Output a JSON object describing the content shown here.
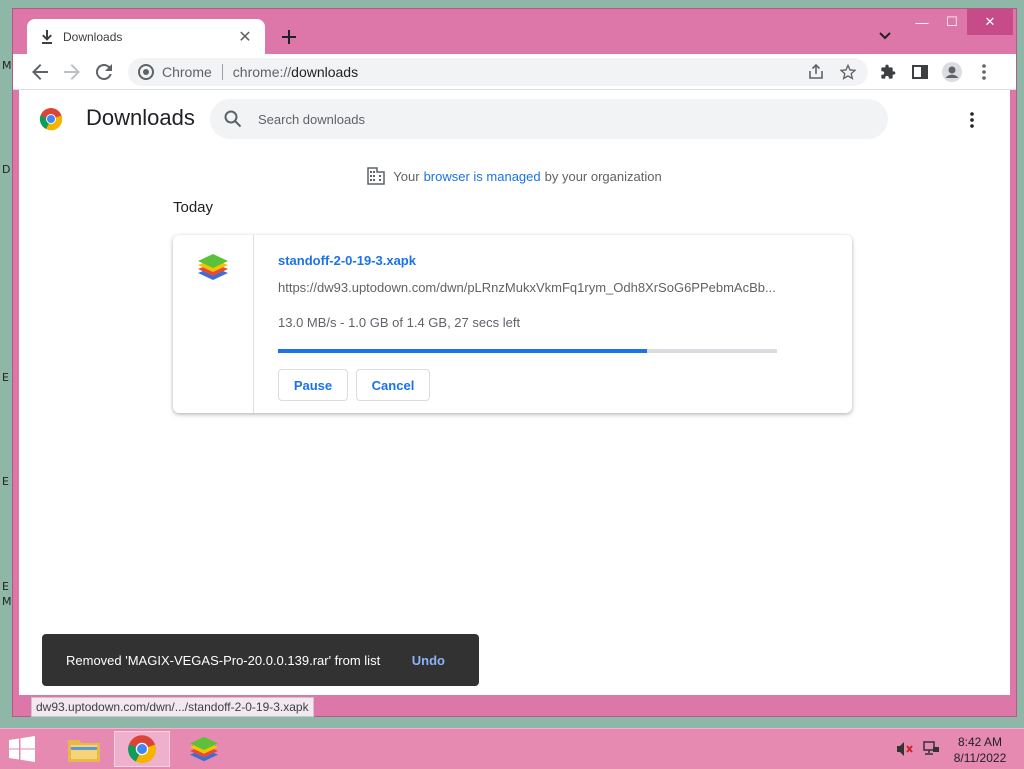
{
  "desktop": {
    "edge_letters": [
      "M",
      "D",
      "E",
      "E",
      "E",
      "M"
    ]
  },
  "tab": {
    "title": "Downloads",
    "close_glyph": "✕"
  },
  "window_controls": {
    "minimize": "—",
    "maximize": "☐",
    "close": "✕"
  },
  "toolbar": {
    "omnibox_chip": "Chrome",
    "url_scheme": "chrome://",
    "url_host": "downloads"
  },
  "downloads_page": {
    "title": "Downloads",
    "search_placeholder": "Search downloads",
    "managed_notice": {
      "prefix": "Your",
      "link": "browser is managed",
      "suffix": "by your organization"
    },
    "section_date": "Today",
    "items": [
      {
        "file_name": "standoff-2-0-19-3.xapk",
        "url": "https://dw93.uptodown.com/dwn/pLRnzMukxVkmFq1rym_Odh8XrSoG6PPebmAcBb...",
        "status": "13.0 MB/s - 1.0 GB of 1.4 GB, 27 secs left",
        "progress_fraction": 0.74,
        "pause_label": "Pause",
        "cancel_label": "Cancel"
      }
    ]
  },
  "toast": {
    "message": "Removed 'MAGIX-VEGAS-Pro-20.0.0.139.rar' from list",
    "undo_label": "Undo"
  },
  "status_bar": {
    "hover_url": "dw93.uptodown.com/dwn/.../standoff-2-0-19-3.xapk"
  },
  "taskbar": {
    "time": "8:42 AM",
    "date": "8/11/2022"
  },
  "colors": {
    "accent": "#1a73e8",
    "window_frame": "#de77a9",
    "taskbar": "#e68ab2"
  }
}
